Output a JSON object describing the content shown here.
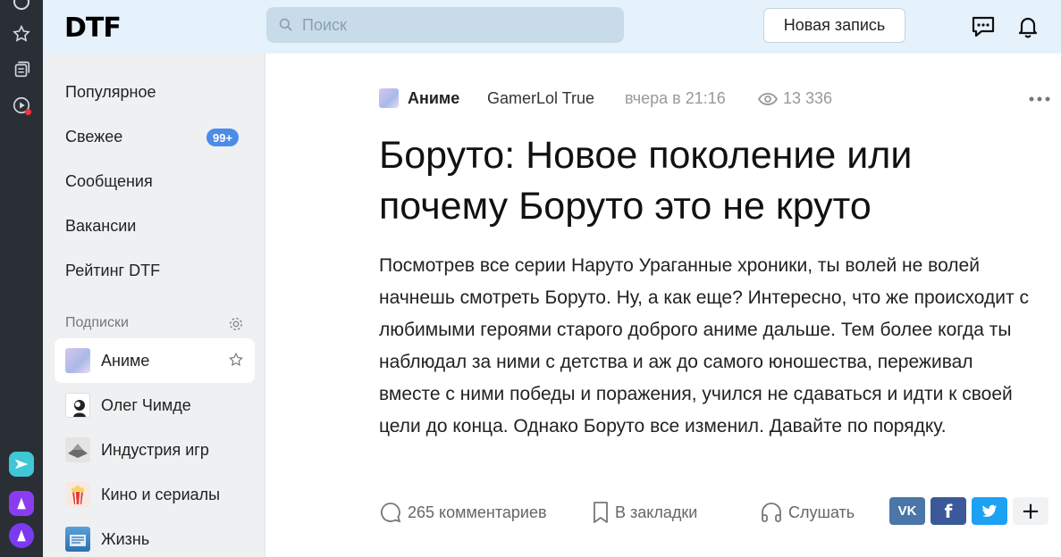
{
  "header": {
    "logo": "DTF",
    "search_placeholder": "Поиск",
    "new_post_label": "Новая запись"
  },
  "sidebar": {
    "nav": [
      {
        "label": "Популярное"
      },
      {
        "label": "Свежее",
        "badge": "99+"
      },
      {
        "label": "Сообщения"
      },
      {
        "label": "Вакансии"
      },
      {
        "label": "Рейтинг DTF"
      }
    ],
    "subscriptions_title": "Подписки",
    "subscriptions": [
      {
        "label": "Аниме",
        "active": true
      },
      {
        "label": "Олег Чимде"
      },
      {
        "label": "Индустрия игр"
      },
      {
        "label": "Кино и сериалы"
      },
      {
        "label": "Жизнь"
      }
    ]
  },
  "article": {
    "category": "Аниме",
    "author": "GamerLol True",
    "time": "вчера в 21:16",
    "views": "13 336",
    "title": "Боруто: Новое поколение или почему Боруто это не круто",
    "body": "Посмотрев все серии Наруто Ураганные хроники, ты волей не волей начнешь смотреть Боруто. Ну, а как еще? Интересно, что же происходит с любимыми героями старого доброго аниме дальше. Тем более когда ты наблюдал за ними с детства и аж до самого юношества, переживал вместе с ними победы и поражения, учился не сдаваться и идти к своей цели до конца. Однако Боруто все изменил. Давайте по порядку.",
    "comments_label": "265 комментариев",
    "bookmark_label": "В закладки",
    "listen_label": "Слушать"
  },
  "share": {
    "vk_label": "VK",
    "fb_label": "f",
    "plus_label": "+"
  },
  "colors": {
    "header_bg": "#e6f2fb",
    "badge": "#4d8be8",
    "vk": "#4a76a8",
    "facebook": "#3b5998",
    "twitter": "#1da1f2"
  }
}
